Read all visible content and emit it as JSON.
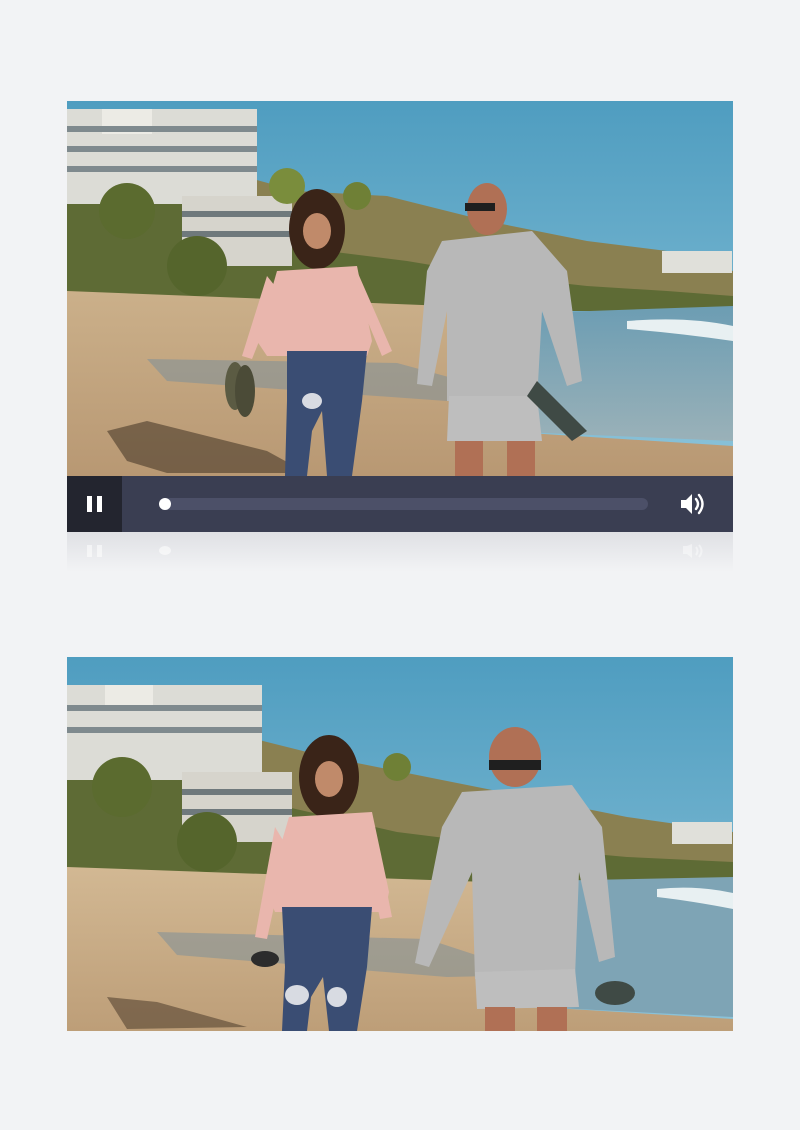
{
  "player": {
    "state": "playing",
    "progress": 0.0,
    "controls": {
      "pause_icon": "pause-icon",
      "volume_icon": "volume-icon"
    },
    "colors": {
      "bar": "#3a3e52",
      "button_bg": "#23252f",
      "track": "#4c5068",
      "knob": "#ffffff"
    }
  },
  "preview": {
    "visible": true
  }
}
